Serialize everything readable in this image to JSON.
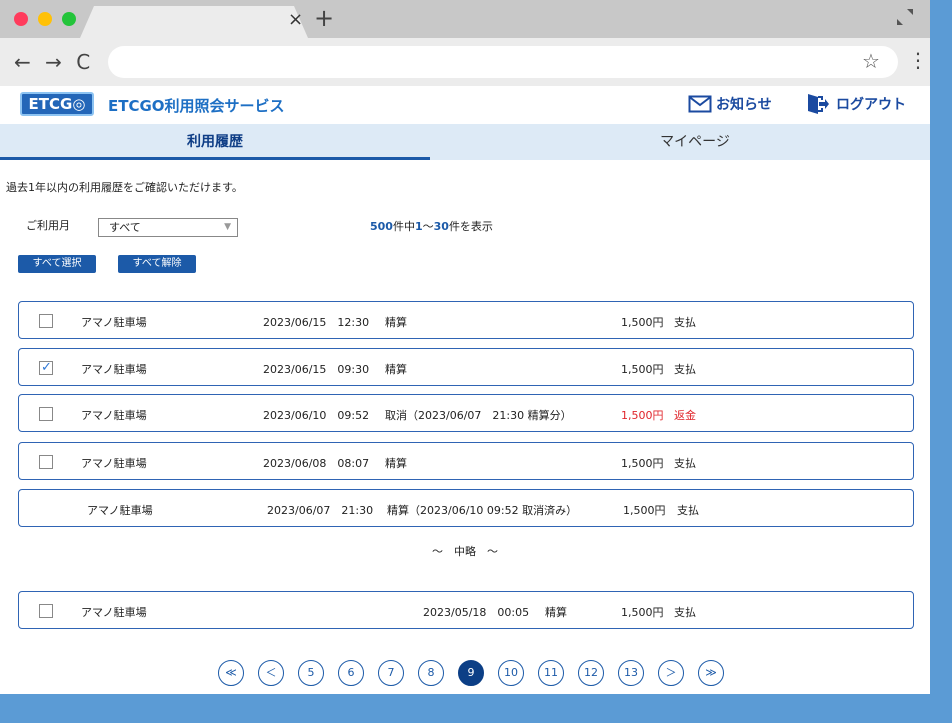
{
  "browser": {
    "tab_close": "×",
    "new_tab": "+",
    "nav": "← → C",
    "star": "☆",
    "menu": "⋮"
  },
  "header": {
    "logo": "ETCG◎",
    "title": "ETCGO利用照会サービス",
    "notice": "お知らせ",
    "logout": "ログアウト"
  },
  "tabs": {
    "active": "利用履歴",
    "other": "マイページ"
  },
  "intro": "過去1年以内の利用履歴をご確認いただけます。",
  "filter": {
    "label": "ご利用月",
    "value": "すべて",
    "arrow": "▼"
  },
  "count": {
    "total": "500",
    "mid": "件中",
    "from": "1",
    "tilde": "〜",
    "to": "30",
    "suffix": "件を表示"
  },
  "buttons": {
    "select_all": "すべて選択",
    "clear_all": "すべて解除"
  },
  "rows": [
    {
      "place": "アマノ駐車場",
      "datetime": "2023/06/15　12:30",
      "type": "精算",
      "amount": "1,500円",
      "status": "支払",
      "checked": false
    },
    {
      "place": "アマノ駐車場",
      "datetime": "2023/06/15　09:30",
      "type": "精算",
      "amount": "1,500円",
      "status": "支払",
      "checked": true
    },
    {
      "place": "アマノ駐車場",
      "datetime": "2023/06/10　09:52",
      "type": "取消（2023/06/07　21:30 精算分）",
      "amount": "1,500円",
      "status": "返金",
      "checked": false
    },
    {
      "place": "アマノ駐車場",
      "datetime": "2023/06/08　08:07",
      "type": "精算",
      "amount": "1,500円",
      "status": "支払",
      "checked": false
    },
    {
      "place": "アマノ駐車場",
      "datetime": "2023/06/07　21:30",
      "type": "精算（2023/06/10 09:52 取消済み）",
      "amount": "1,500円",
      "status": "支払"
    },
    {
      "place": "アマノ駐車場",
      "datetime": "2023/05/18　00:05",
      "type": "精算",
      "amount": "1,500円",
      "status": "支払",
      "checked": false
    }
  ],
  "omitted": "〜　中略　〜",
  "pagination": {
    "first": "≪",
    "prev": "＜",
    "pages": [
      "5",
      "6",
      "7",
      "8",
      "9",
      "10",
      "11",
      "12",
      "13"
    ],
    "current": "9",
    "next": "＞",
    "last": "≫"
  },
  "colors": {
    "accent": "#1c5aa8",
    "refund": "#e0252b",
    "background": "#5b9bd5"
  }
}
